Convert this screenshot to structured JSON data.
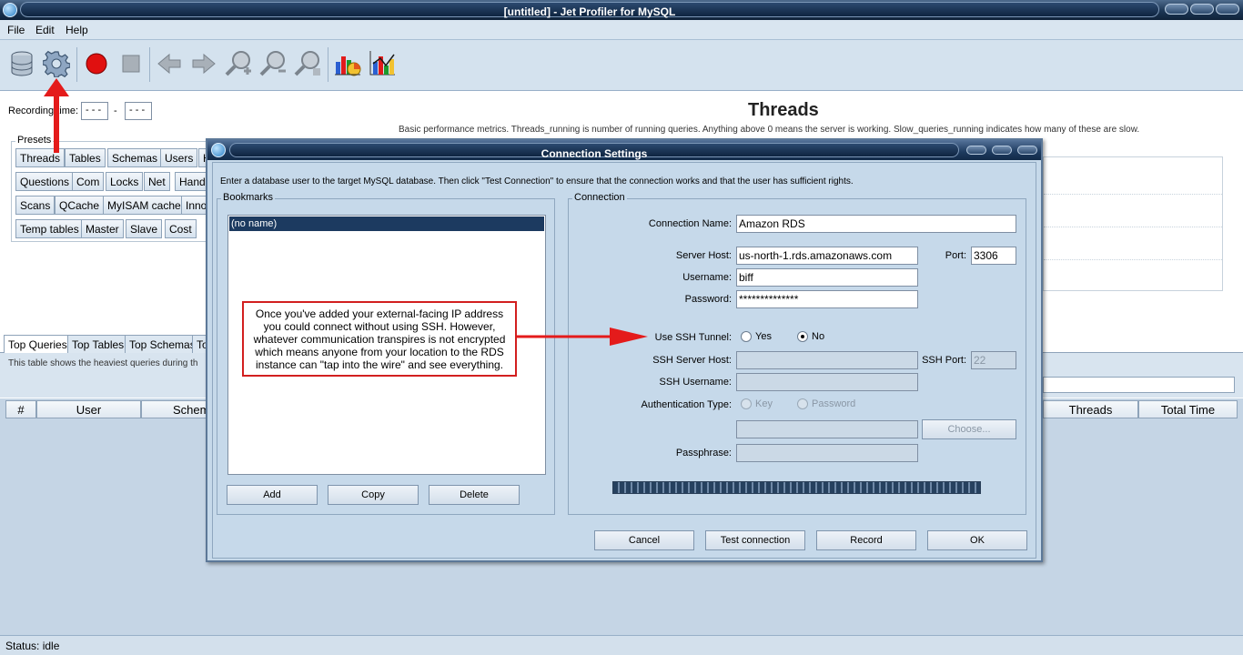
{
  "app": {
    "title": "[untitled] - Jet Profiler for MySQL"
  },
  "menu": {
    "items": [
      "File",
      "Edit",
      "Help"
    ]
  },
  "toolbar": {
    "buttons": [
      "database-icon",
      "gear-icon",
      "record-icon",
      "stop-icon",
      "back-arrow-icon",
      "forward-arrow-icon",
      "zoom-in-icon",
      "zoom-out-icon",
      "zoom-reset-icon",
      "bar-pie-chart-icon",
      "bar-chart-icon"
    ]
  },
  "recording": {
    "label": "Recording time:",
    "start": "- - -",
    "separator": "-",
    "end": "- - -"
  },
  "threads": {
    "title": "Threads",
    "description": "Basic performance metrics. Threads_running is number of running queries. Anything above 0 means the server is working. Slow_queries_running indicates how many of these are slow."
  },
  "presets": {
    "label": "Presets",
    "rows": [
      [
        "Threads",
        "Tables",
        "Schemas",
        "Users",
        "Handl"
      ],
      [
        "Questions",
        "Com",
        "Locks",
        "Net",
        "Handl"
      ],
      [
        "Scans",
        "QCache",
        "MyISAM cache",
        "Inno"
      ],
      [
        "Temp tables",
        "Master",
        "Slave",
        "Cost"
      ]
    ]
  },
  "bottom": {
    "tabs": [
      "Top Queries",
      "Top Tables",
      "Top Schemas",
      "To"
    ],
    "description": "This table shows the heaviest queries during th",
    "columns": [
      "#",
      "User",
      "Schem",
      "Threads",
      "Total Time"
    ]
  },
  "status": {
    "text": "Status: idle"
  },
  "dialog": {
    "title": "Connection Settings",
    "intro": "Enter a database user to the target MySQL database. Then click \"Test Connection\" to ensure that the connection works and that the user has sufficient rights.",
    "bookmarks": {
      "label": "Bookmarks",
      "items": [
        "(no name)"
      ],
      "add": "Add",
      "copy": "Copy",
      "delete": "Delete"
    },
    "connection": {
      "label": "Connection",
      "name_label": "Connection Name:",
      "name_value": "Amazon RDS",
      "host_label": "Server Host:",
      "host_value": "us-north-1.rds.amazonaws.com",
      "port_label": "Port:",
      "port_value": "3306",
      "user_label": "Username:",
      "user_value": "biff",
      "pass_label": "Password:",
      "pass_value": "**************",
      "ssh_tunnel_label": "Use SSH Tunnel:",
      "yes": "Yes",
      "no": "No",
      "ssh_tunnel_selected": "No",
      "ssh_host_label": "SSH Server Host:",
      "ssh_host_value": "",
      "ssh_port_label": "SSH Port:",
      "ssh_port_value": "22",
      "ssh_user_label": "SSH Username:",
      "ssh_user_value": "",
      "auth_label": "Authentication Type:",
      "auth_key": "Key",
      "auth_password": "Password",
      "choose": "Choose...",
      "passphrase_label": "Passphrase:",
      "passphrase_value": ""
    },
    "buttons": {
      "cancel": "Cancel",
      "test": "Test connection",
      "record": "Record",
      "ok": "OK"
    }
  },
  "callout": {
    "text": "Once you've added your external-facing IP address you could connect without using SSH.  However, whatever communication transpires is not encrypted which means anyone from your location to the RDS instance can \"tap into the wire\" and see everything."
  },
  "colors": {
    "accent_red": "#e41b1b",
    "title_dark": "#1c3654",
    "panel": "#c6d9ea"
  }
}
